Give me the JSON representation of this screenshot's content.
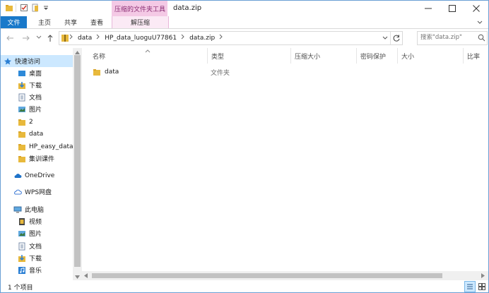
{
  "window": {
    "title": "data.zip"
  },
  "quick_access_toolbar": {
    "icons": [
      "folder-icon",
      "properties-icon",
      "new-folder-icon",
      "customize-arrow-icon"
    ]
  },
  "context_tab": {
    "label": "压缩的文件夹工具",
    "sub_label": "解压缩",
    "color": "#8a2d73",
    "bg": "#f4c9e5"
  },
  "ribbon": {
    "tabs": [
      "文件",
      "主页",
      "共享",
      "查看"
    ],
    "file_color": "#1979ca"
  },
  "address": {
    "crumbs": [
      "data",
      "HP_data_luoguU77861",
      "data.zip"
    ],
    "search_placeholder": "搜索\"data.zip\""
  },
  "nav": {
    "quick_access": "快速访问",
    "pinned": [
      {
        "label": "桌面",
        "icon": "desktop-icon"
      },
      {
        "label": "下载",
        "icon": "download-icon"
      },
      {
        "label": "文档",
        "icon": "documents-icon"
      },
      {
        "label": "图片",
        "icon": "pictures-icon"
      }
    ],
    "folders": [
      "2",
      "data",
      "HP_easy_data_l",
      "集训课件"
    ],
    "onedrive": "OneDrive",
    "wps": "WPS网盘",
    "this_pc": "此电脑",
    "pc_items": [
      {
        "label": "视频",
        "icon": "videos-icon"
      },
      {
        "label": "图片",
        "icon": "pictures-icon"
      },
      {
        "label": "文档",
        "icon": "documents-icon"
      },
      {
        "label": "下载",
        "icon": "download-icon"
      },
      {
        "label": "音乐",
        "icon": "music-icon"
      }
    ]
  },
  "columns": [
    "名称",
    "类型",
    "压缩大小",
    "密码保护",
    "大小",
    "比率"
  ],
  "files": [
    {
      "name": "data",
      "type": "文件夹"
    }
  ],
  "status": {
    "count": "1 个项目"
  }
}
